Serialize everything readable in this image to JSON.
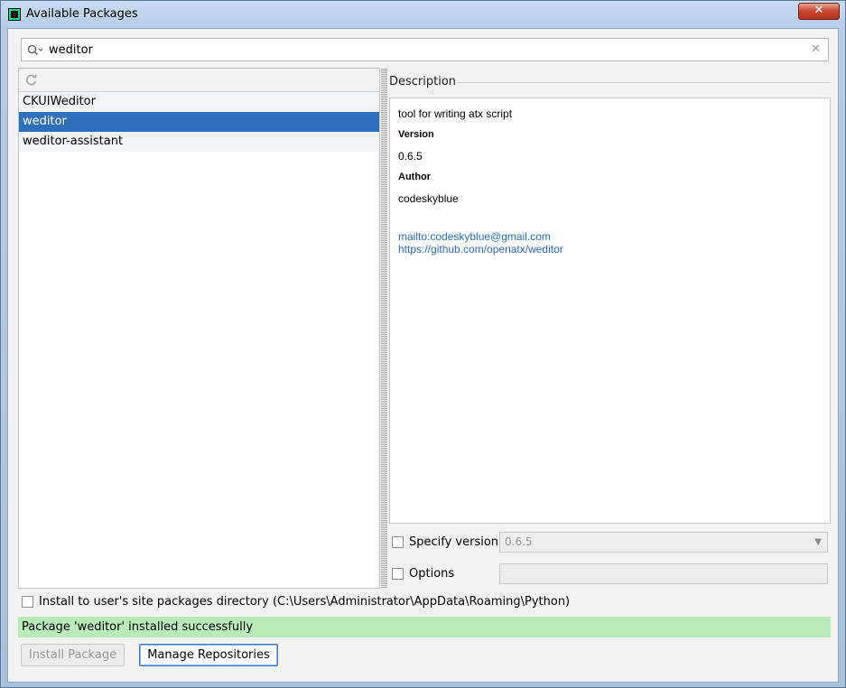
{
  "window": {
    "title": "Available Packages",
    "close_symbol": "✕"
  },
  "search": {
    "value": "weditor",
    "placeholder": ""
  },
  "packages": [
    {
      "name": "CKUIWeditor",
      "selected": false
    },
    {
      "name": "weditor",
      "selected": true
    },
    {
      "name": "weditor-assistant",
      "selected": false
    }
  ],
  "description": {
    "label": "Description",
    "summary": "tool for writing atx script",
    "version_heading": "Version",
    "version_value": "0.6.5",
    "author_heading": "Author",
    "author_value": "codeskyblue",
    "mail_link": "mailto:codeskyblue@gmail.com",
    "repo_link": "https://github.com/openatx/weditor"
  },
  "options": {
    "specify_version_label": "Specify version",
    "specify_version_checked": false,
    "version_selected": "0.6.5",
    "options_label": "Options",
    "options_checked": false,
    "options_value": ""
  },
  "install_to_user": {
    "label": "Install to user's site packages directory (C:\\Users\\Administrator\\AppData\\Roaming\\Python)",
    "checked": false
  },
  "status": {
    "message": "Package 'weditor' installed successfully",
    "color": "#b9ebbb"
  },
  "buttons": {
    "install": "Install Package",
    "manage": "Manage Repositories"
  },
  "colors": {
    "selection": "#2f6eb8",
    "link": "#2a6ab8"
  }
}
